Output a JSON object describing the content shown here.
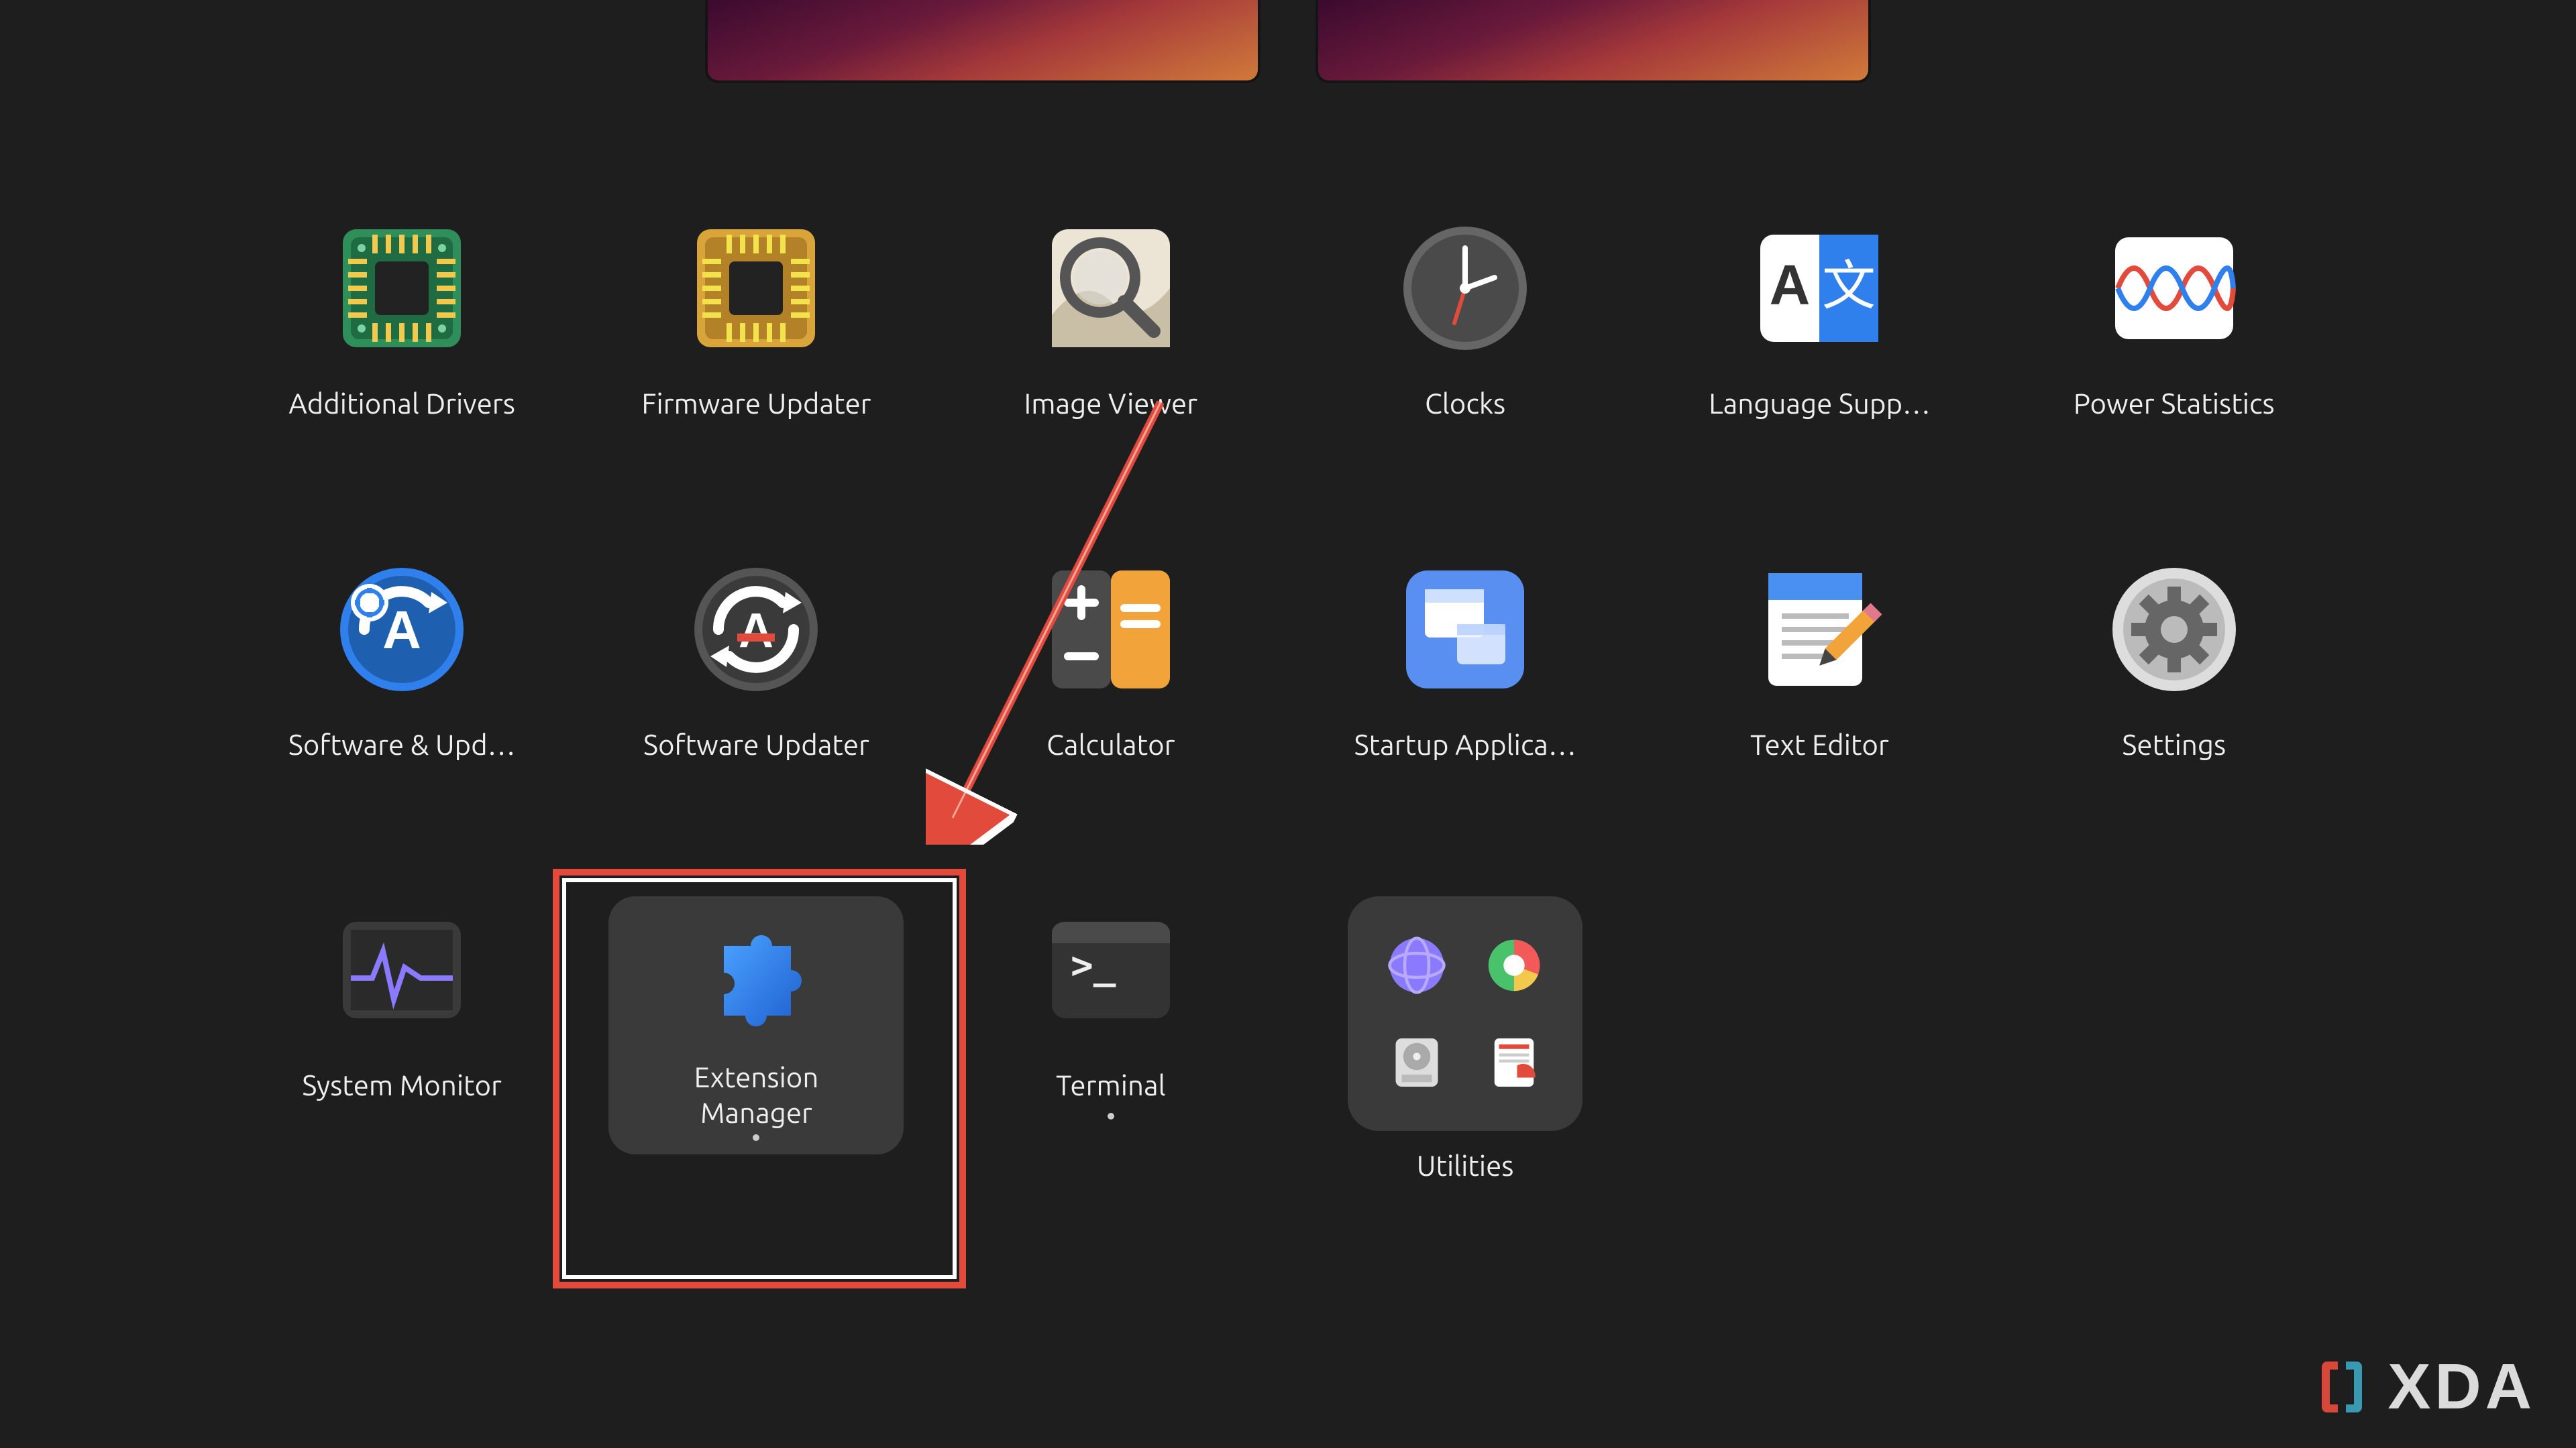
{
  "workspace_count": 2,
  "apps": {
    "row1": [
      {
        "label": "Additional Drivers"
      },
      {
        "label": "Firmware Updater"
      },
      {
        "label": "Image Viewer"
      },
      {
        "label": "Clocks"
      },
      {
        "label": "Language Supp…"
      },
      {
        "label": "Power Statistics"
      }
    ],
    "row2": [
      {
        "label": "Software & Upd…"
      },
      {
        "label": "Software Updater"
      },
      {
        "label": "Calculator"
      },
      {
        "label": "Startup Applica…"
      },
      {
        "label": "Text Editor"
      },
      {
        "label": "Settings"
      }
    ],
    "row3": [
      {
        "label": "System Monitor"
      },
      {
        "label": "Extension Manager"
      },
      {
        "label": "Terminal"
      },
      {
        "label": "Utilities"
      }
    ]
  },
  "highlighted_app": "Extension Manager",
  "watermark": "XDA",
  "colors": {
    "bg": "#1e1e1e",
    "tile": "#3a3a3a",
    "highlight_red": "#e24a3b",
    "accent_blue": "#2f80ed",
    "green": "#2e8f5a",
    "mustard": "#d9a43a",
    "orange": "#f2a43a"
  }
}
